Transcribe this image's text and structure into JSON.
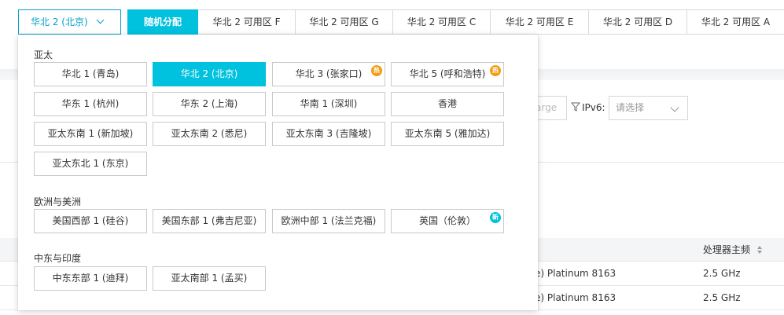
{
  "region_select": {
    "value": "华北 2 (北京)",
    "icon": "chevron-down-icon"
  },
  "zone_tabs": [
    {
      "label": "随机分配",
      "active": true
    },
    {
      "label": "华北 2 可用区 F"
    },
    {
      "label": "华北 2 可用区 G"
    },
    {
      "label": "华北 2 可用区 C"
    },
    {
      "label": "华北 2 可用区 E"
    },
    {
      "label": "华北 2 可用区 D"
    },
    {
      "label": "华北 2 可用区 A"
    }
  ],
  "dropdown": {
    "groups": [
      {
        "title": "亚太",
        "regions": [
          {
            "label": "华北 1 (青岛)"
          },
          {
            "label": "华北 2 (北京)",
            "selected": true
          },
          {
            "label": "华北 3 (张家口)",
            "badge": "hot"
          },
          {
            "label": "华北 5 (呼和浩特)",
            "badge": "hot"
          },
          {
            "label": "华东 1 (杭州)"
          },
          {
            "label": "华东 2 (上海)"
          },
          {
            "label": "华南 1 (深圳)"
          },
          {
            "label": "香港"
          },
          {
            "label": "亚太东南 1 (新加坡)"
          },
          {
            "label": "亚太东南 2 (悉尼)"
          },
          {
            "label": "亚太东南 3 (吉隆坡)"
          },
          {
            "label": "亚太东南 5 (雅加达)"
          },
          {
            "label": "亚太东北 1 (东京)"
          }
        ]
      },
      {
        "title": "欧洲与美洲",
        "regions": [
          {
            "label": "美国西部 1 (硅谷)"
          },
          {
            "label": "美国东部 1 (弗吉尼亚)"
          },
          {
            "label": "欧洲中部 1 (法兰克福)"
          },
          {
            "label": "英国（伦敦）",
            "badge": "new"
          }
        ]
      },
      {
        "title": "中东与印度",
        "regions": [
          {
            "label": "中东东部 1 (迪拜)"
          },
          {
            "label": "亚太南部 1 (孟买)"
          }
        ]
      }
    ],
    "badge_text": {
      "new": "新",
      "hot": "热"
    },
    "badge_colors": {
      "new": "#00c1de",
      "hot": "#f39c12"
    }
  },
  "background": {
    "search_placeholder_fragment": "arge",
    "ipv6_label": "IPv6:",
    "ipv6_select_placeholder": "请选择",
    "table": {
      "freq_header": "处理器主频",
      "rows": [
        {
          "cpu": "e) Platinum 8163",
          "freq": "2.5 GHz"
        },
        {
          "cpu": "e) Platinum 8163",
          "freq": "2.5 GHz"
        }
      ]
    }
  },
  "colors": {
    "accent": "#00c1de",
    "accent_dark": "#00a2ca"
  }
}
